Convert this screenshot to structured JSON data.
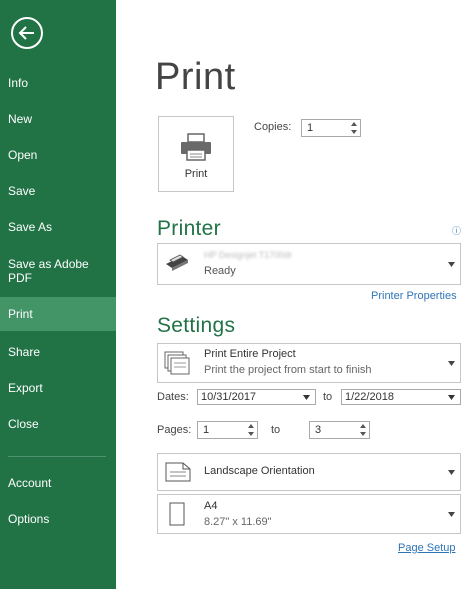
{
  "sidebar": {
    "items": [
      {
        "label": "Info"
      },
      {
        "label": "New"
      },
      {
        "label": "Open"
      },
      {
        "label": "Save"
      },
      {
        "label": "Save As"
      },
      {
        "label": "Save as Adobe PDF"
      },
      {
        "label": "Print"
      },
      {
        "label": "Share"
      },
      {
        "label": "Export"
      },
      {
        "label": "Close"
      },
      {
        "label": "Account"
      },
      {
        "label": "Options"
      }
    ],
    "active": "Print",
    "colors": {
      "background": "#217346",
      "active": "#439467"
    }
  },
  "main": {
    "title": "Print",
    "print_button": {
      "label": "Print",
      "icon": "printer-icon"
    },
    "copies": {
      "label": "Copies:",
      "value": "1"
    },
    "printer": {
      "section_title": "Printer",
      "name": "HP Designjet T1700dr",
      "status": "Ready",
      "properties_link": "Printer Properties"
    },
    "settings": {
      "section_title": "Settings",
      "range": {
        "line1": "Print Entire Project",
        "line2": "Print the project from start to finish"
      },
      "dates": {
        "label": "Dates:",
        "from": "10/31/2017",
        "to_label": "to",
        "to": "1/22/2018"
      },
      "pages": {
        "label": "Pages:",
        "from": "1",
        "to_label": "to",
        "to": "3"
      },
      "orientation": {
        "label": "Landscape Orientation"
      },
      "paper": {
        "line1": "A4",
        "line2": "8.27\" x 11.69\""
      },
      "page_setup_link": "Page Setup"
    }
  }
}
